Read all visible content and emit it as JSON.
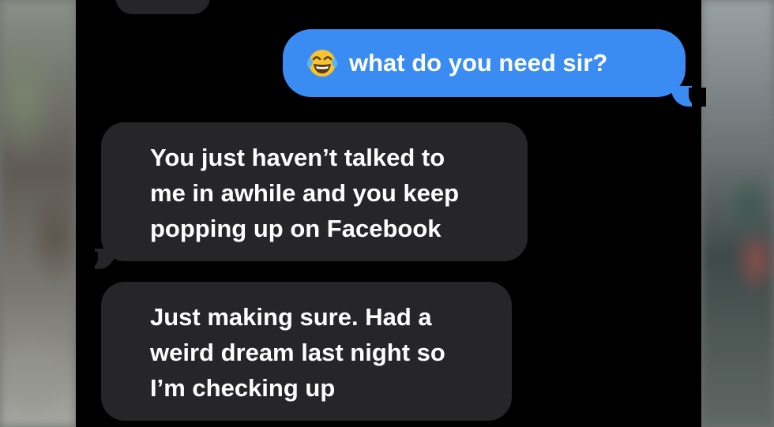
{
  "conversation": {
    "sent_message": {
      "emoji_icon": "face-with-tears-of-joy-icon",
      "text": "what do you need sir?"
    },
    "received_messages": [
      {
        "lines": [
          "You just haven’t talked to",
          "me in awhile and you keep",
          "popping up on Facebook"
        ]
      },
      {
        "lines": [
          "Just making sure. Had a",
          "weird dream last night so",
          "I’m checking up"
        ]
      }
    ]
  },
  "colors": {
    "sent_bubble": "#3a8cf2",
    "received_bubble": "#262628",
    "background": "#000000",
    "text": "#ffffff"
  }
}
